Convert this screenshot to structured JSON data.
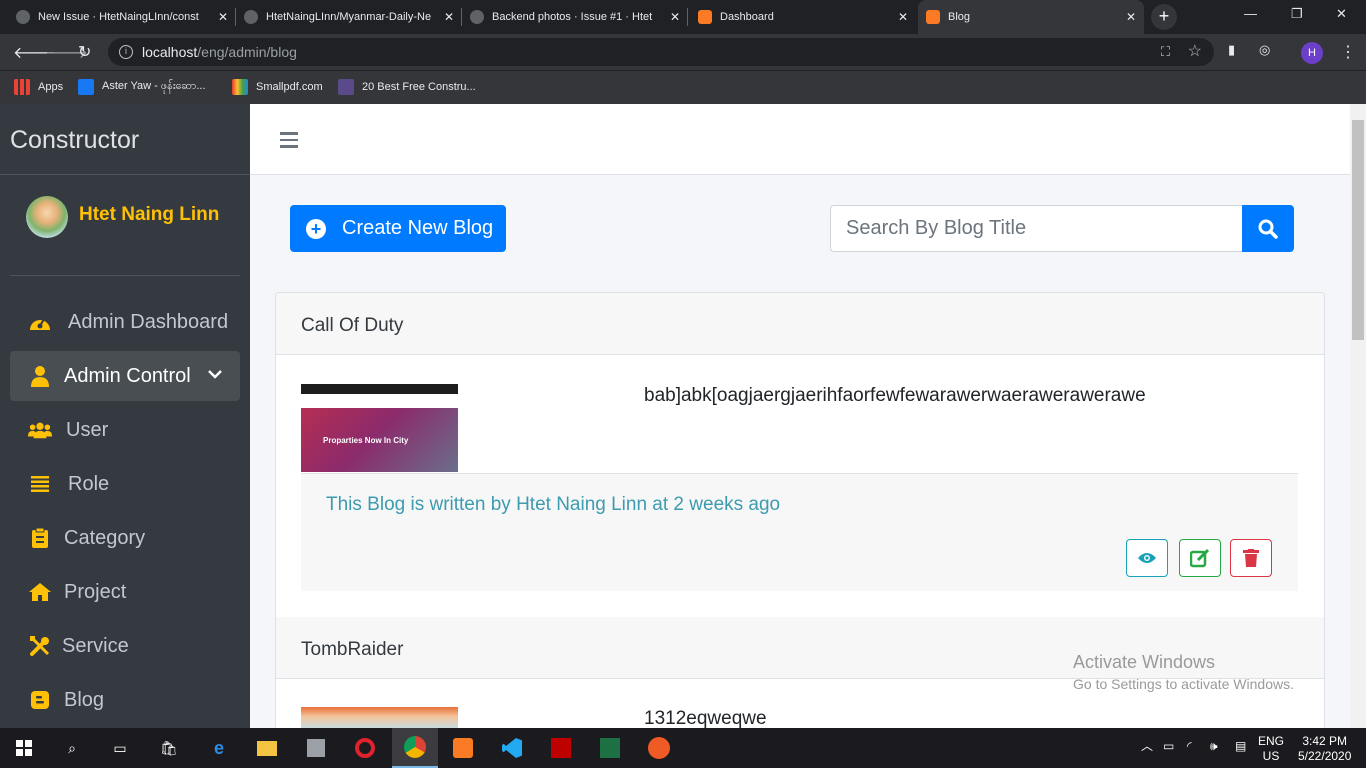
{
  "browser": {
    "tabs": [
      {
        "title": "New Issue · HtetNaingLInn/const"
      },
      {
        "title": "HtetNaingLInn/Myanmar-Daily-Ne"
      },
      {
        "title": "Backend photos · Issue #1 · Htet"
      },
      {
        "title": "Dashboard"
      },
      {
        "title": "Blog"
      }
    ],
    "url_host": "localhost",
    "url_path": "/eng/admin/blog",
    "profile_initial": "H",
    "bookmarks": [
      {
        "label": "Apps"
      },
      {
        "label": "Aster Yaw - ဖုန်းဆော..."
      },
      {
        "label": "Smallpdf.com"
      },
      {
        "label": "20 Best Free Constru..."
      }
    ]
  },
  "sidebar": {
    "brand": "Constructor",
    "user_name": "Htet Naing Linn",
    "items": [
      {
        "label": "Admin Dashboard",
        "icon": "tachometer-icon"
      },
      {
        "label": "Admin Control",
        "icon": "user-icon"
      },
      {
        "label": "User",
        "icon": "users-icon"
      },
      {
        "label": "Role",
        "icon": "list-icon"
      },
      {
        "label": "Category",
        "icon": "clipboard-icon"
      },
      {
        "label": "Project",
        "icon": "home-icon"
      },
      {
        "label": "Service",
        "icon": "tools-icon"
      },
      {
        "label": "Blog",
        "icon": "blog-icon"
      }
    ]
  },
  "main": {
    "create_label": "Create New Blog",
    "search_placeholder": "Search By Blog Title",
    "blogs": [
      {
        "title": "Call Of Duty",
        "excerpt": "bab]abk[oagjaergjaerihfaorfewfewarawerwaerawerawerawe",
        "meta": "This Blog is written by Htet Naing Linn at 2 weeks ago",
        "thumb_caption": "Proparties Now In City"
      },
      {
        "title": "TombRaider",
        "excerpt": "1312eqweqwe"
      }
    ]
  },
  "watermark": {
    "line1": "Activate Windows",
    "line2": "Go to Settings to activate Windows."
  },
  "taskbar": {
    "lang": "ENG",
    "region": "US",
    "time": "3:42 PM",
    "date": "5/22/2020"
  },
  "colors": {
    "sidebar_bg": "#343a40",
    "accent": "#007bff",
    "username": "#ffc107",
    "meta_text": "#3d9bb0"
  }
}
